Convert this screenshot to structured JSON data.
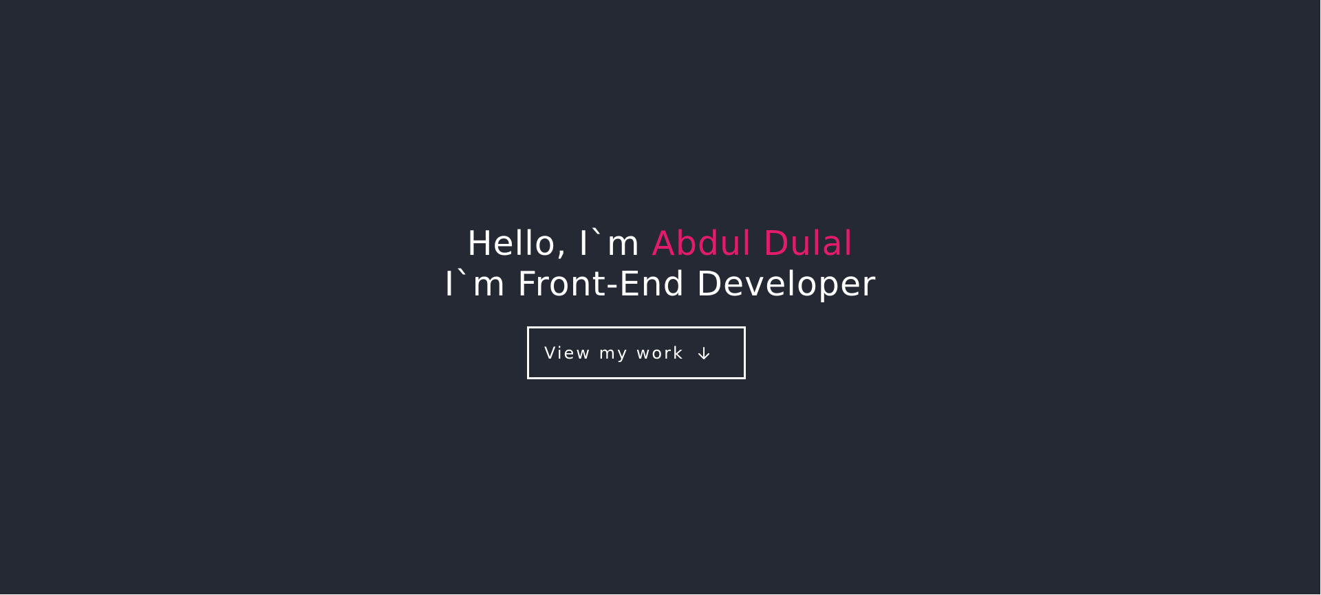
{
  "colors": {
    "background": "#252934",
    "text": "#ffffff",
    "accent": "#e31b6d"
  },
  "hero": {
    "greeting": "Hello, I`m ",
    "name": "Abdul Dulal",
    "role": "I`m Front-End Developer",
    "cta": {
      "label": "View my work",
      "icon": "arrow-down-icon"
    }
  }
}
